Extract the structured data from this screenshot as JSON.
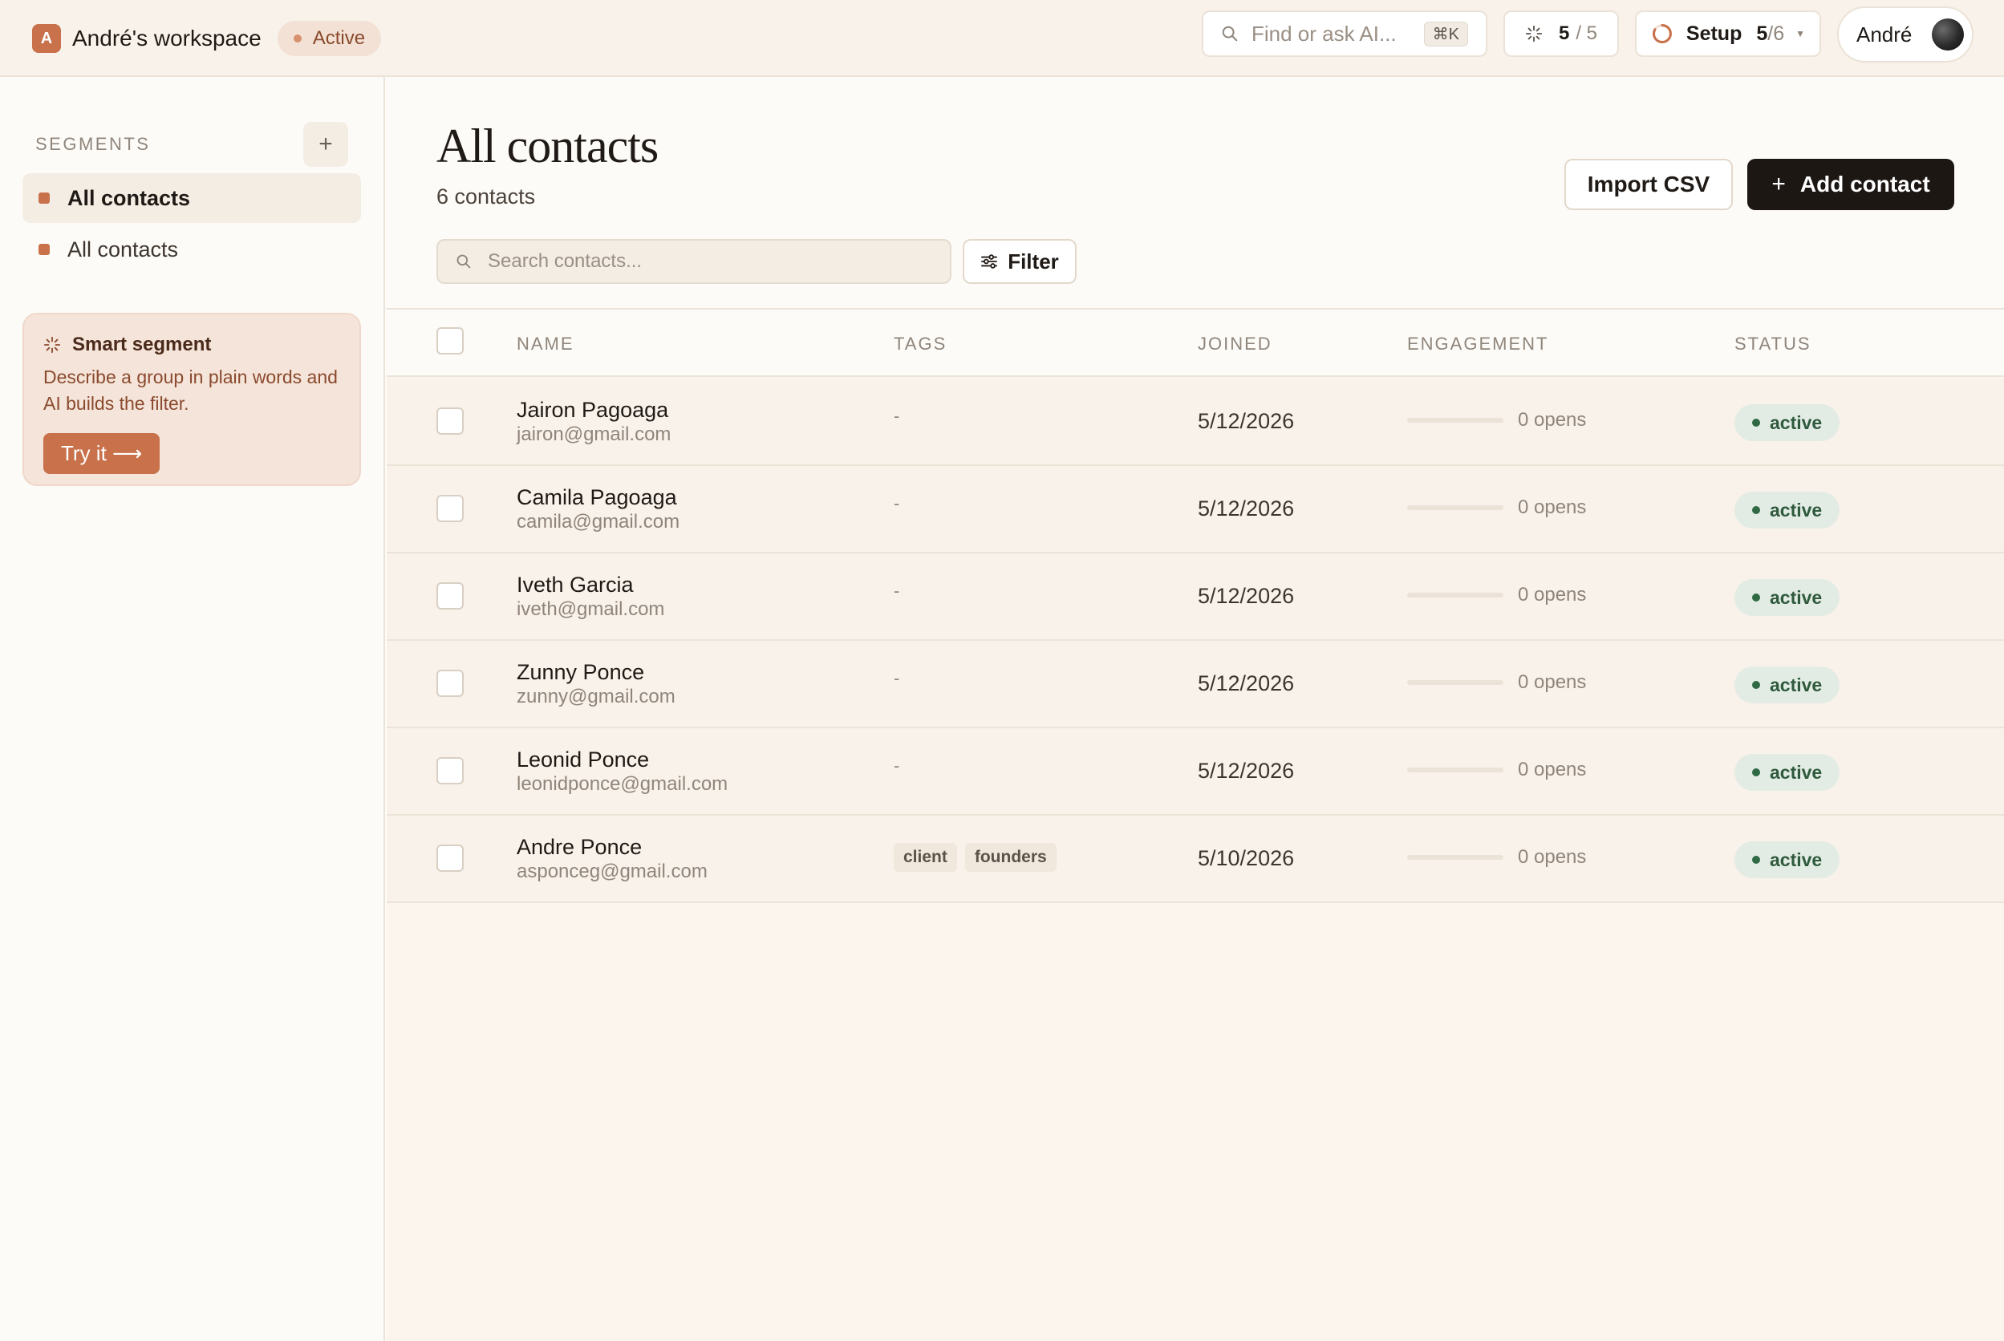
{
  "workspace": {
    "logo_letter": "A",
    "name": "André's workspace",
    "status": "Active"
  },
  "topbar": {
    "search_placeholder": "Find or ask AI...",
    "search_shortcut": "⌘K",
    "counter": {
      "current": "5",
      "total": "/ 5"
    },
    "setup": {
      "label": "Setup",
      "done": "5",
      "total": "/6",
      "progress": 0.83
    },
    "user_name": "André"
  },
  "sidebar": {
    "segments_title": "SEGMENTS",
    "add_icon": "+",
    "items": [
      {
        "label": "All contacts",
        "active": true
      },
      {
        "label": "All contacts",
        "active": false
      }
    ],
    "smart": {
      "title": "Smart segment",
      "description": "Describe a group in plain words and AI builds the filter.",
      "button": "Try it ⟶"
    }
  },
  "main": {
    "title": "All contacts",
    "count": "6 contacts",
    "import_label": "Import CSV",
    "add_label": "Add contact",
    "add_icon": "+",
    "search_placeholder": "Search contacts...",
    "filter_label": "Filter",
    "columns": {
      "name": "NAME",
      "tags": "TAGS",
      "joined": "JOINED",
      "engagement": "ENGAGEMENT",
      "status": "STATUS"
    },
    "rows": [
      {
        "name": "Jairon Pagoaga",
        "email": "jairon@gmail.com",
        "tags": "-",
        "tag_list": [],
        "joined": "5/12/2026",
        "engagement_value": 0,
        "engagement": "0 opens",
        "status": "active"
      },
      {
        "name": "Camila Pagoaga",
        "email": "camila@gmail.com",
        "tags": "-",
        "tag_list": [],
        "joined": "5/12/2026",
        "engagement_value": 0,
        "engagement": "0 opens",
        "status": "active"
      },
      {
        "name": "Iveth Garcia",
        "email": "iveth@gmail.com",
        "tags": "-",
        "tag_list": [],
        "joined": "5/12/2026",
        "engagement_value": 0,
        "engagement": "0 opens",
        "status": "active"
      },
      {
        "name": "Zunny Ponce",
        "email": "zunny@gmail.com",
        "tags": "-",
        "tag_list": [],
        "joined": "5/12/2026",
        "engagement_value": 0,
        "engagement": "0 opens",
        "status": "active"
      },
      {
        "name": "Leonid Ponce",
        "email": "leonidponce@gmail.com",
        "tags": "-",
        "tag_list": [],
        "joined": "5/12/2026",
        "engagement_value": 0,
        "engagement": "0 opens",
        "status": "active"
      },
      {
        "name": "Andre Ponce",
        "email": "asponceg@gmail.com",
        "tags": "",
        "tag_list": [
          "client",
          "founders"
        ],
        "joined": "5/10/2026",
        "engagement_value": 0,
        "engagement": "0 opens",
        "status": "active"
      }
    ]
  },
  "colors": {
    "accent": "#c8714a",
    "dark": "#1d1714",
    "status_green": "#2f6a44",
    "bg": "#fdfbf7"
  }
}
